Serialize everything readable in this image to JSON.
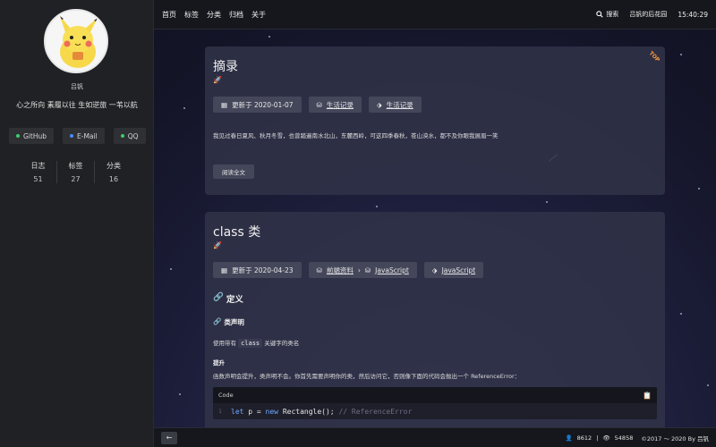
{
  "sidebar": {
    "author": "吕钒",
    "motto": "心之所向 素履以往 生如逆旅 一苇以航",
    "links": [
      {
        "label": "GitHub",
        "color": "#3ccf6b",
        "icon": "github-dot"
      },
      {
        "label": "E-Mail",
        "color": "#4a8cff",
        "icon": "email-dot"
      },
      {
        "label": "QQ",
        "color": "#3ccf6b",
        "icon": "qq-dot"
      }
    ],
    "stats": [
      {
        "label": "日志",
        "value": "51"
      },
      {
        "label": "标签",
        "value": "27"
      },
      {
        "label": "分类",
        "value": "16"
      }
    ]
  },
  "header": {
    "nav": [
      "首页",
      "标签",
      "分类",
      "归档",
      "关于"
    ],
    "search": "搜索",
    "site_name": "吕钒的后花园",
    "time": "15:40:29"
  },
  "post1": {
    "title": "摘录",
    "ribbon": "TOP",
    "updated": "更新于 2020-01-07",
    "category": "生活记录",
    "tag": "生活记录",
    "excerpt": "我见过春日夏风、秋月冬雪，也曾踏遍南水北山，东麓西岭，可这四季春秋，苍山泱水，都不及你眼我展眉一笑",
    "read_more": "阅读全文"
  },
  "post2": {
    "title": "class 类",
    "updated": "更新于 2020-04-23",
    "category_parent": "前端资料",
    "category": "JavaScript",
    "tag": "JavaScript",
    "h_definition": "定义",
    "h_declaration": "类声明",
    "p_declaration_pre": "使用带有",
    "p_declaration_code": "class",
    "p_declaration_post": "关键字的类名",
    "h_hoisting": "提升",
    "p_hoisting": "函数声明会提升，类声明不会。你首先需要声明你的类，然后访问它，否则像下面的代码会抛出一个 ReferenceError：",
    "code_header": "Code",
    "code_line_no": "1",
    "code_kw1": "let",
    "code_mid1": " p = ",
    "code_kw2": "new",
    "code_mid2": " Rectangle(); ",
    "code_comment": "// ReferenceError"
  },
  "footer": {
    "visitors": "8612",
    "views": "54858",
    "copyright": "©2017 ～ 2020 By 吕钒"
  }
}
